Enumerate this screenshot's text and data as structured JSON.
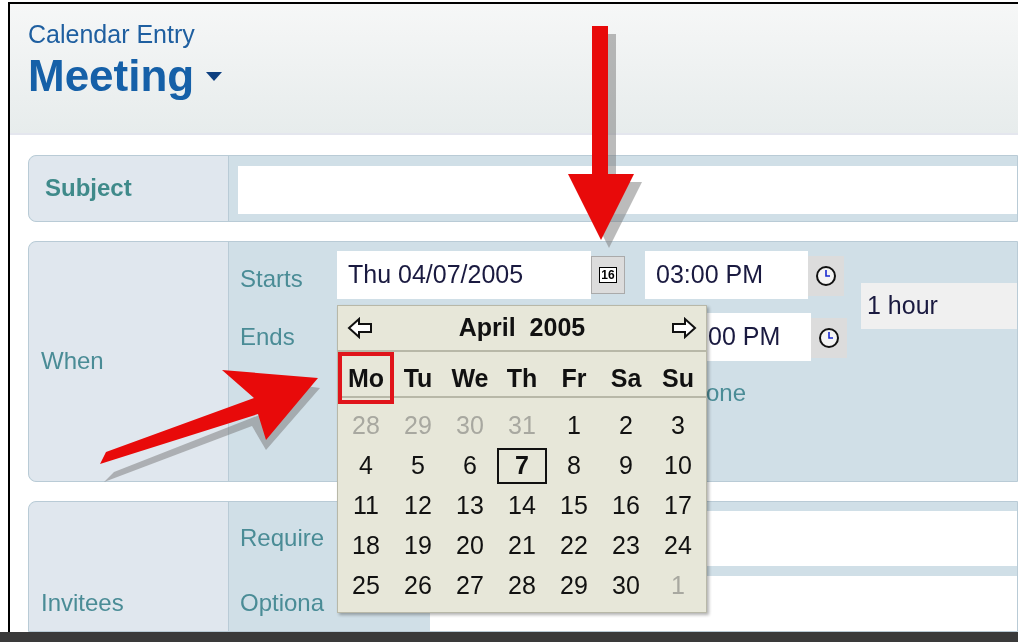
{
  "header": {
    "subtitle": "Calendar Entry",
    "title": "Meeting"
  },
  "subject": {
    "label": "Subject"
  },
  "when": {
    "label": "When",
    "starts_label": "Starts",
    "start_date": "Thu 04/07/2005",
    "calendar_button": "16",
    "start_time": "03:00 PM",
    "duration": "1 hour",
    "ends_label": "Ends",
    "end_time": "00 PM",
    "time_zone": "one"
  },
  "invitees": {
    "label": "Invitees",
    "required_label": "Require",
    "optional_label": "Optiona"
  },
  "date_picker": {
    "month": "April",
    "year": "2005",
    "weekdays": [
      {
        "label": "Mo",
        "highlighted": true
      },
      {
        "label": "Tu",
        "highlighted": false
      },
      {
        "label": "We",
        "highlighted": false
      },
      {
        "label": "Th",
        "highlighted": false
      },
      {
        "label": "Fr",
        "highlighted": false
      },
      {
        "label": "Sa",
        "highlighted": false
      },
      {
        "label": "Su",
        "highlighted": false
      }
    ],
    "days": [
      {
        "label": "28",
        "other_month": true,
        "selected": false
      },
      {
        "label": "29",
        "other_month": true,
        "selected": false
      },
      {
        "label": "30",
        "other_month": true,
        "selected": false
      },
      {
        "label": "31",
        "other_month": true,
        "selected": false
      },
      {
        "label": "1",
        "other_month": false,
        "selected": false
      },
      {
        "label": "2",
        "other_month": false,
        "selected": false
      },
      {
        "label": "3",
        "other_month": false,
        "selected": false
      },
      {
        "label": "4",
        "other_month": false,
        "selected": false
      },
      {
        "label": "5",
        "other_month": false,
        "selected": false
      },
      {
        "label": "6",
        "other_month": false,
        "selected": false
      },
      {
        "label": "7",
        "other_month": false,
        "selected": true
      },
      {
        "label": "8",
        "other_month": false,
        "selected": false
      },
      {
        "label": "9",
        "other_month": false,
        "selected": false
      },
      {
        "label": "10",
        "other_month": false,
        "selected": false
      },
      {
        "label": "11",
        "other_month": false,
        "selected": false
      },
      {
        "label": "12",
        "other_month": false,
        "selected": false
      },
      {
        "label": "13",
        "other_month": false,
        "selected": false
      },
      {
        "label": "14",
        "other_month": false,
        "selected": false
      },
      {
        "label": "15",
        "other_month": false,
        "selected": false
      },
      {
        "label": "16",
        "other_month": false,
        "selected": false
      },
      {
        "label": "17",
        "other_month": false,
        "selected": false
      },
      {
        "label": "18",
        "other_month": false,
        "selected": false
      },
      {
        "label": "19",
        "other_month": false,
        "selected": false
      },
      {
        "label": "20",
        "other_month": false,
        "selected": false
      },
      {
        "label": "21",
        "other_month": false,
        "selected": false
      },
      {
        "label": "22",
        "other_month": false,
        "selected": false
      },
      {
        "label": "23",
        "other_month": false,
        "selected": false
      },
      {
        "label": "24",
        "other_month": false,
        "selected": false
      },
      {
        "label": "25",
        "other_month": false,
        "selected": false
      },
      {
        "label": "26",
        "other_month": false,
        "selected": false
      },
      {
        "label": "27",
        "other_month": false,
        "selected": false
      },
      {
        "label": "28",
        "other_month": false,
        "selected": false
      },
      {
        "label": "29",
        "other_month": false,
        "selected": false
      },
      {
        "label": "30",
        "other_month": false,
        "selected": false
      },
      {
        "label": "1",
        "other_month": true,
        "selected": false
      }
    ]
  }
}
